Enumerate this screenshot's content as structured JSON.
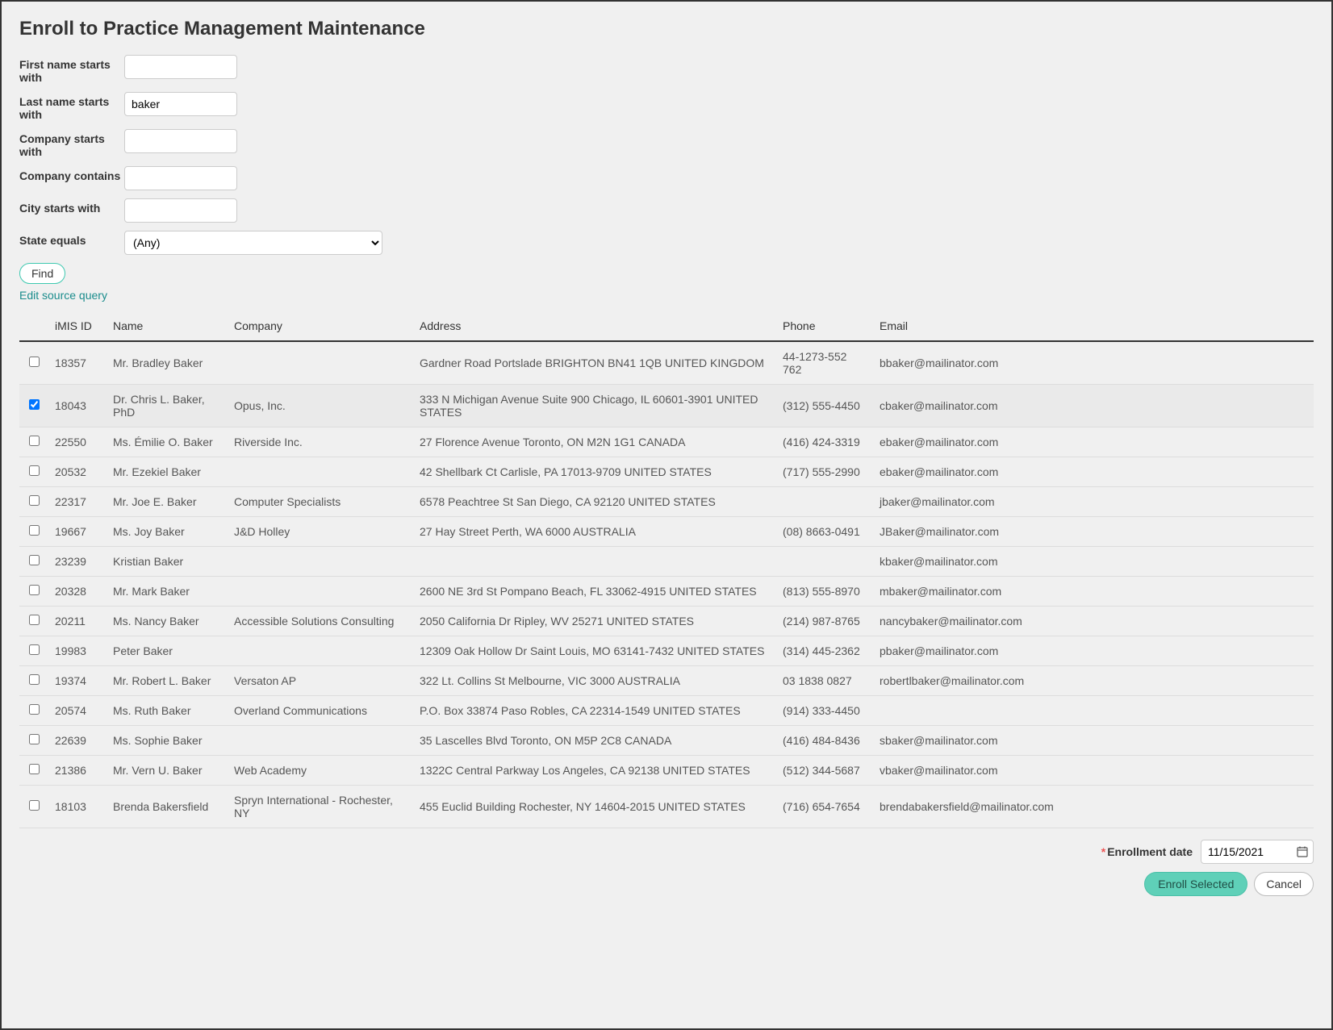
{
  "title": "Enroll to Practice Management Maintenance",
  "form": {
    "first_name_label": "First name starts with",
    "first_name_value": "",
    "last_name_label": "Last name starts with",
    "last_name_value": "baker",
    "company_starts_label": "Company starts with",
    "company_starts_value": "",
    "company_contains_label": "Company contains",
    "company_contains_value": "",
    "city_label": "City starts with",
    "city_value": "",
    "state_label": "State equals",
    "state_value": "(Any)",
    "find_label": "Find",
    "edit_query_label": "Edit source query"
  },
  "table": {
    "headers": {
      "id": "iMIS ID",
      "name": "Name",
      "company": "Company",
      "address": "Address",
      "phone": "Phone",
      "email": "Email"
    },
    "rows": [
      {
        "checked": false,
        "id": "18357",
        "name": "Mr. Bradley Baker",
        "company": "",
        "address": "Gardner Road Portslade BRIGHTON BN41 1QB UNITED KINGDOM",
        "phone": "44-1273-552 762",
        "email": "bbaker@mailinator.com"
      },
      {
        "checked": true,
        "id": "18043",
        "name": "Dr. Chris L. Baker, PhD",
        "company": "Opus, Inc.",
        "address": "333 N Michigan Avenue Suite 900 Chicago, IL 60601-3901 UNITED STATES",
        "phone": "(312) 555-4450",
        "email": "cbaker@mailinator.com"
      },
      {
        "checked": false,
        "id": "22550",
        "name": "Ms. Émilie O. Baker",
        "company": "Riverside Inc.",
        "address": "27 Florence Avenue Toronto, ON M2N 1G1 CANADA",
        "phone": "(416) 424-3319",
        "email": "ebaker@mailinator.com"
      },
      {
        "checked": false,
        "id": "20532",
        "name": "Mr. Ezekiel Baker",
        "company": "",
        "address": "42 Shellbark Ct Carlisle, PA 17013-9709 UNITED STATES",
        "phone": "(717) 555-2990",
        "email": "ebaker@mailinator.com"
      },
      {
        "checked": false,
        "id": "22317",
        "name": "Mr. Joe E. Baker",
        "company": "Computer Specialists",
        "address": "6578 Peachtree St San Diego, CA 92120 UNITED STATES",
        "phone": "",
        "email": "jbaker@mailinator.com"
      },
      {
        "checked": false,
        "id": "19667",
        "name": "Ms. Joy Baker",
        "company": "J&D Holley",
        "address": "27 Hay Street Perth, WA 6000 AUSTRALIA",
        "phone": "(08) 8663-0491",
        "email": "JBaker@mailinator.com"
      },
      {
        "checked": false,
        "id": "23239",
        "name": "Kristian Baker",
        "company": "",
        "address": "",
        "phone": "",
        "email": "kbaker@mailinator.com"
      },
      {
        "checked": false,
        "id": "20328",
        "name": "Mr. Mark Baker",
        "company": "",
        "address": "2600 NE 3rd St Pompano Beach, FL 33062-4915 UNITED STATES",
        "phone": "(813) 555-8970",
        "email": "mbaker@mailinator.com"
      },
      {
        "checked": false,
        "id": "20211",
        "name": "Ms. Nancy Baker",
        "company": "Accessible Solutions Consulting",
        "address": "2050 California Dr Ripley, WV 25271 UNITED STATES",
        "phone": "(214) 987-8765",
        "email": "nancybaker@mailinator.com"
      },
      {
        "checked": false,
        "id": "19983",
        "name": "Peter Baker",
        "company": "",
        "address": "12309 Oak Hollow Dr Saint Louis, MO 63141-7432 UNITED STATES",
        "phone": "(314) 445-2362",
        "email": "pbaker@mailinator.com"
      },
      {
        "checked": false,
        "id": "19374",
        "name": "Mr. Robert L. Baker",
        "company": "Versaton AP",
        "address": "322 Lt. Collins St Melbourne, VIC 3000 AUSTRALIA",
        "phone": "03 1838 0827",
        "email": "robertlbaker@mailinator.com"
      },
      {
        "checked": false,
        "id": "20574",
        "name": "Ms. Ruth Baker",
        "company": "Overland Communications",
        "address": "P.O. Box 33874 Paso Robles, CA 22314-1549 UNITED STATES",
        "phone": "(914) 333-4450",
        "email": ""
      },
      {
        "checked": false,
        "id": "22639",
        "name": "Ms. Sophie Baker",
        "company": "",
        "address": "35 Lascelles Blvd Toronto, ON M5P 2C8 CANADA",
        "phone": "(416) 484-8436",
        "email": "sbaker@mailinator.com"
      },
      {
        "checked": false,
        "id": "21386",
        "name": "Mr. Vern U. Baker",
        "company": "Web Academy",
        "address": "1322C Central Parkway Los Angeles, CA 92138 UNITED STATES",
        "phone": "(512) 344-5687",
        "email": "vbaker@mailinator.com"
      },
      {
        "checked": false,
        "id": "18103",
        "name": "Brenda Bakersfield",
        "company": "Spryn International - Rochester, NY",
        "address": "455 Euclid Building Rochester, NY 14604-2015 UNITED STATES",
        "phone": "(716) 654-7654",
        "email": "brendabakersfield@mailinator.com"
      }
    ]
  },
  "footer": {
    "enrollment_date_label": "Enrollment date",
    "enrollment_date_value": "11/15/2021",
    "enroll_selected_label": "Enroll Selected",
    "cancel_label": "Cancel"
  }
}
